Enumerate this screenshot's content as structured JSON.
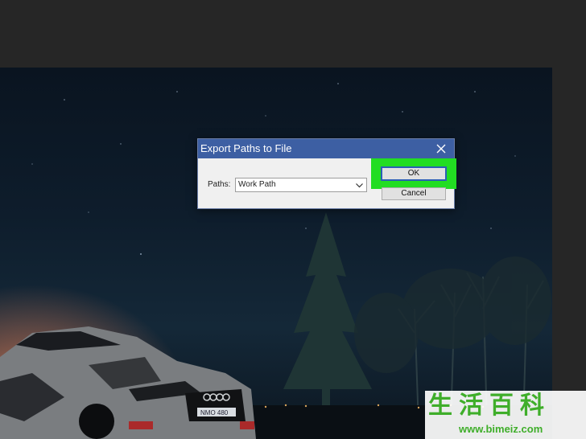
{
  "dialog": {
    "title": "Export Paths to File",
    "close_icon": "close-icon",
    "paths_label": "Paths:",
    "paths_value": "Work Path",
    "ok_label": "OK",
    "cancel_label": "Cancel"
  },
  "watermark": {
    "cn_text": "生活百科",
    "url_text": "www.bimeiz.com"
  },
  "colors": {
    "titlebar": "#3d5fa3",
    "highlight": "#22dd22",
    "workspace": "#262626",
    "ok_border": "#2b5fb5"
  }
}
